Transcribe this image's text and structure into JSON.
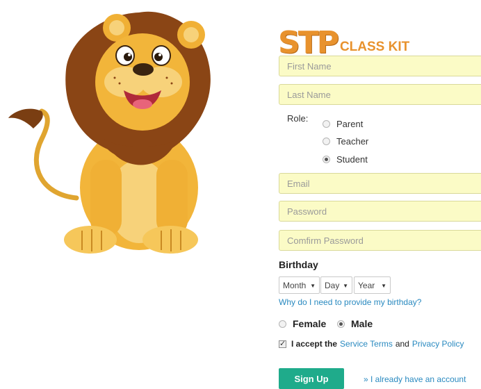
{
  "logo": {
    "mark": "STP",
    "text": "CLASS KIT"
  },
  "form": {
    "first_name": {
      "placeholder": "First Name"
    },
    "last_name": {
      "placeholder": "Last Name"
    },
    "role": {
      "label": "Role:",
      "options": [
        {
          "label": "Parent",
          "selected": false
        },
        {
          "label": "Teacher",
          "selected": false
        },
        {
          "label": "Student",
          "selected": true
        }
      ]
    },
    "email": {
      "placeholder": "Email"
    },
    "password": {
      "placeholder": "Password"
    },
    "confirm_password": {
      "placeholder": "Comfirm Password"
    },
    "birthday": {
      "label": "Birthday",
      "month": "Month",
      "day": "Day",
      "year": "Year",
      "why_link": "Why do I need to provide my birthday?"
    },
    "gender": {
      "options": [
        {
          "label": "Female",
          "selected": false
        },
        {
          "label": "Male",
          "selected": true
        }
      ]
    },
    "terms": {
      "checked": true,
      "prefix": "I accept the",
      "service_terms": "Service Terms",
      "and": "and",
      "privacy_policy": "Privacy Policy"
    },
    "signup_label": "Sign Up",
    "already_link": "» I already have an account"
  },
  "colors": {
    "input_bg": "#fbfbc6",
    "button": "#1fab8b",
    "link": "#2a8ac0",
    "logo": "#e8922d"
  }
}
